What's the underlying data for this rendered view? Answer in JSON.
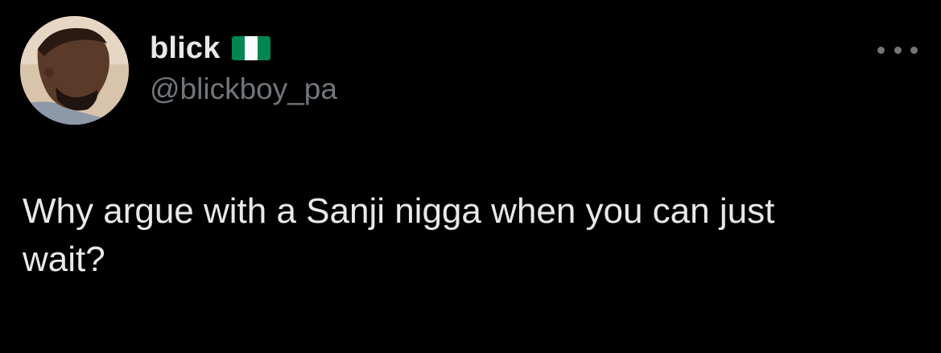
{
  "author": {
    "display_name": "blick",
    "handle": "@blickboy_pa",
    "flag_icon": "nigeria-flag-icon",
    "avatar_icon": "profile-photo-avatar"
  },
  "actions": {
    "more_icon": "more-options-icon"
  },
  "tweet": {
    "text": "Why argue with a Sanji nigga when you can just\nwait?"
  },
  "colors": {
    "background": "#000000",
    "primary_text": "#e7e9ea",
    "secondary_text": "#71767b",
    "flag_green": "#008751",
    "flag_white": "#ffffff"
  }
}
